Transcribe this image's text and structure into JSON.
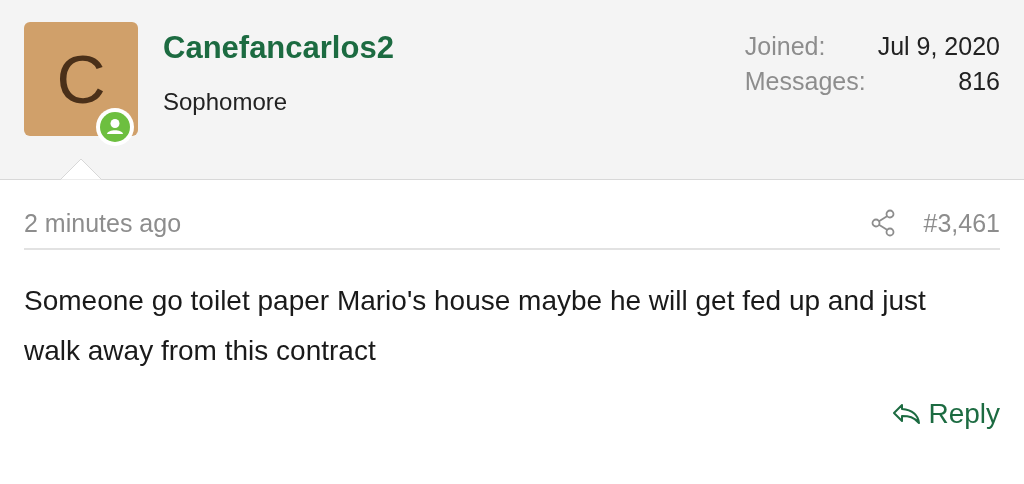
{
  "user": {
    "avatar_letter": "C",
    "online": true,
    "name": "Canefancarlos2",
    "title": "Sophomore"
  },
  "stats": [
    {
      "label": "Joined:",
      "value": "Jul 9, 2020"
    },
    {
      "label": "Messages:",
      "value": "816"
    }
  ],
  "post": {
    "time": "2 minutes ago",
    "number": "#3,461",
    "body": "Someone go toilet paper Mario's house maybe he will get fed up and just walk away from this contract",
    "reply": "Reply"
  }
}
